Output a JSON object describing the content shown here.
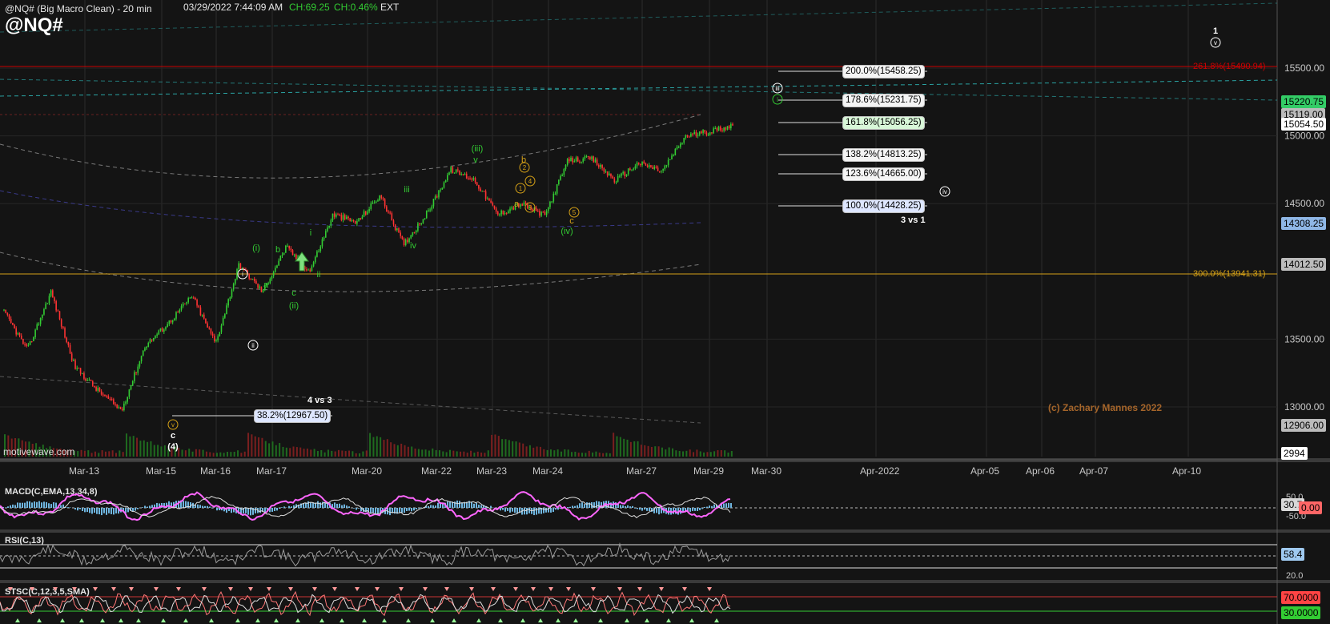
{
  "header": {
    "title": "@NQ# (Big Macro Clean) - 20 min",
    "datetime": "03/29/2022 7:44:09 AM",
    "change_points": "CH:69.25",
    "change_pct": "CH:0.46%",
    "session": "EXT",
    "symbol": "@NQ#"
  },
  "watermark": "motivewave.com",
  "copyright": "(c) Zachary Mannes 2022",
  "colors": {
    "background": "#141414",
    "up_candle": "#33cc33",
    "down_candle": "#ff3333",
    "fib_red": "#cc0000",
    "fib_gold": "#d4a017",
    "channel_cyan": "#2aa3a3",
    "wave_green": "#33cc33",
    "wave_gold": "#d4a017"
  },
  "price_axis": {
    "ticks": [
      "15500.00",
      "15000.00",
      "14500.00",
      "13500.00",
      "13000.00"
    ],
    "badges": [
      {
        "label": "15220.75",
        "bg": "#33cc66",
        "fg": "#000000"
      },
      {
        "label": "15119.00",
        "bg": "#bbbbbb",
        "fg": "#000000"
      },
      {
        "label": "15054.50",
        "bg": "#ffffff",
        "fg": "#000000"
      },
      {
        "label": "14308.25",
        "bg": "#8fb7e6",
        "fg": "#000000"
      },
      {
        "label": "14012.50",
        "bg": "#bbbbbb",
        "fg": "#000000"
      },
      {
        "label": "12906.00",
        "bg": "#bbbbbb",
        "fg": "#000000"
      },
      {
        "label": "2994",
        "bg": "#ffffff",
        "fg": "#000000"
      }
    ]
  },
  "time_axis": [
    "Mar-13",
    "Mar-15",
    "Mar-16",
    "Mar-17",
    "Mar-20",
    "Mar-22",
    "Mar-23",
    "Mar-24",
    "Mar-27",
    "Mar-29",
    "Mar-30",
    "Apr-2022",
    "Apr-05",
    "Apr-06",
    "Apr-07",
    "Apr-10"
  ],
  "fib_labels": [
    {
      "text": "200.0%(15458.25)",
      "style": "fib-w"
    },
    {
      "text": "178.6%(15231.75)",
      "style": "fib-w"
    },
    {
      "text": "161.8%(15056.25)",
      "style": "fib-g"
    },
    {
      "text": "138.2%(14813.25)",
      "style": "fib-w"
    },
    {
      "text": "123.6%(14665.00)",
      "style": "fib-w"
    },
    {
      "text": "100.0%(14428.25)",
      "style": "fib-b"
    },
    {
      "text": "38.2%(12967.50)",
      "style": "fib-b"
    }
  ],
  "fib_levels": [
    {
      "text": "261.8%(15490.94)",
      "color": "#cc0000"
    },
    {
      "text": "300.0%(13941.31)",
      "color": "#d4a017"
    }
  ],
  "plain_labels": [
    "3 vs 1",
    "4 vs 3"
  ],
  "wave_labels": [
    {
      "text": "1",
      "kind": "plain",
      "color": "#ffffff"
    },
    {
      "text": "v",
      "kind": "circle",
      "color": "#ffffff"
    },
    {
      "text": "iii",
      "kind": "circle",
      "color": "#ffffff"
    },
    {
      "text": "i",
      "kind": "circle",
      "color": "#33cc33"
    },
    {
      "text": "iv",
      "kind": "circle",
      "color": "#ffffff"
    },
    {
      "text": "(iii)",
      "kind": "plain",
      "color": "#33cc33"
    },
    {
      "text": "v",
      "kind": "plain",
      "color": "#33cc33"
    },
    {
      "text": "b",
      "kind": "plain",
      "color": "#d4a017"
    },
    {
      "text": "2",
      "kind": "circle",
      "color": "#d4a017"
    },
    {
      "text": "1",
      "kind": "circle",
      "color": "#d4a017"
    },
    {
      "text": "4",
      "kind": "circle",
      "color": "#d4a017"
    },
    {
      "text": "a",
      "kind": "plain",
      "color": "#d4a017"
    },
    {
      "text": "3",
      "kind": "circle",
      "color": "#d4a017"
    },
    {
      "text": "5",
      "kind": "circle",
      "color": "#d4a017"
    },
    {
      "text": "c",
      "kind": "plain",
      "color": "#d4a017"
    },
    {
      "text": "(iv)",
      "kind": "plain",
      "color": "#33cc33"
    },
    {
      "text": "iii",
      "kind": "plain",
      "color": "#33cc33"
    },
    {
      "text": "iv",
      "kind": "plain",
      "color": "#33cc33"
    },
    {
      "text": "i",
      "kind": "plain",
      "color": "#33cc33"
    },
    {
      "text": "ii",
      "kind": "plain",
      "color": "#33cc33"
    },
    {
      "text": "(i)",
      "kind": "plain",
      "color": "#33cc33"
    },
    {
      "text": "b",
      "kind": "plain",
      "color": "#33cc33"
    },
    {
      "text": "a",
      "kind": "plain",
      "color": "#33cc33"
    },
    {
      "text": "c",
      "kind": "plain",
      "color": "#33cc33"
    },
    {
      "text": "(ii)",
      "kind": "plain",
      "color": "#33cc33"
    },
    {
      "text": "i",
      "kind": "circle",
      "color": "#ffffff"
    },
    {
      "text": "ii",
      "kind": "circle",
      "color": "#ffffff"
    },
    {
      "text": "v",
      "kind": "circle",
      "color": "#d4a017"
    },
    {
      "text": "c",
      "kind": "plain",
      "color": "#ffffff"
    },
    {
      "text": "(4)",
      "kind": "plain",
      "color": "#ffffff"
    }
  ],
  "indicators": {
    "macd": {
      "label": "MACD(C,EMA,13,34,8)",
      "ticks": [
        "50.0",
        "-50.0"
      ],
      "value": "30.7",
      "value2": "0.00"
    },
    "rsi": {
      "label": "RSI(C,13)",
      "ticks": [
        "20.0"
      ],
      "value": "58.4"
    },
    "stoch": {
      "label": "STSC(C,12,3,5,SMA)",
      "values": [
        "70.0000",
        "30.0000"
      ]
    }
  },
  "chart_data": {
    "type": "candlestick",
    "symbol": "@NQ#",
    "interval": "20 min",
    "ylim": [
      12850,
      15720
    ],
    "path": [
      {
        "date": "Mar-12",
        "close": 13700
      },
      {
        "date": "Mar-13",
        "close": 13420
      },
      {
        "date": "Mar-13",
        "close": 13850
      },
      {
        "date": "Mar-14",
        "close": 13300
      },
      {
        "date": "Mar-14",
        "close": 13120
      },
      {
        "date": "Mar-15",
        "close": 12975
      },
      {
        "date": "Mar-15",
        "close": 13450
      },
      {
        "date": "Mar-16",
        "close": 13620
      },
      {
        "date": "Mar-16",
        "close": 13820
      },
      {
        "date": "Mar-16",
        "close": 13470
      },
      {
        "date": "Mar-17",
        "close": 14050
      },
      {
        "date": "Mar-17",
        "close": 13850
      },
      {
        "date": "Mar-18",
        "close": 14180
      },
      {
        "date": "Mar-18",
        "close": 14000
      },
      {
        "date": "Mar-20",
        "close": 14420
      },
      {
        "date": "Mar-21",
        "close": 14360
      },
      {
        "date": "Mar-21",
        "close": 14560
      },
      {
        "date": "Mar-21",
        "close": 14200
      },
      {
        "date": "Mar-22",
        "close": 14430
      },
      {
        "date": "Mar-22",
        "close": 14750
      },
      {
        "date": "Mar-23",
        "close": 14680
      },
      {
        "date": "Mar-23",
        "close": 14420
      },
      {
        "date": "Mar-24",
        "close": 14500
      },
      {
        "date": "Mar-24",
        "close": 14410
      },
      {
        "date": "Mar-25",
        "close": 14820
      },
      {
        "date": "Mar-26",
        "close": 14830
      },
      {
        "date": "Mar-27",
        "close": 14670
      },
      {
        "date": "Mar-27",
        "close": 14800
      },
      {
        "date": "Mar-28",
        "close": 14740
      },
      {
        "date": "Mar-28",
        "close": 15000
      },
      {
        "date": "Mar-29",
        "close": 15030
      },
      {
        "date": "Mar-29",
        "close": 15080
      }
    ]
  }
}
